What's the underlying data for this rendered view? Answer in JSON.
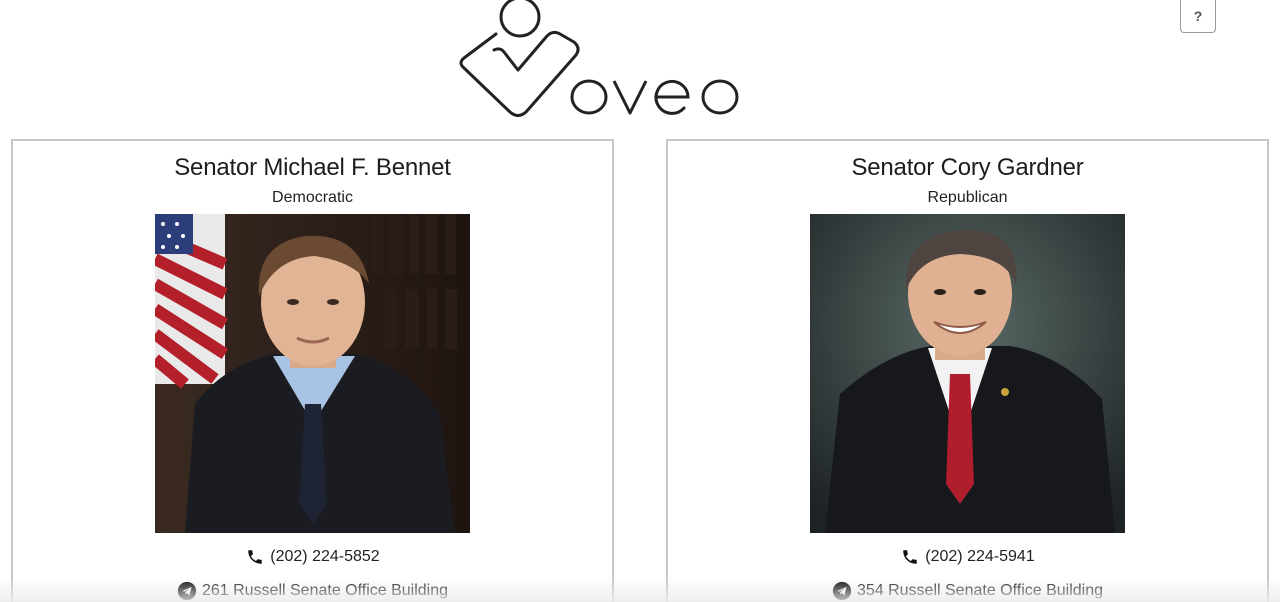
{
  "app": {
    "brand": "voveo"
  },
  "header": {
    "help_label": "?"
  },
  "senators": [
    {
      "name": "Senator Michael F. Bennet",
      "party": "Democratic",
      "phone": "(202) 224-5852",
      "office": "261 Russell Senate Office Building"
    },
    {
      "name": "Senator Cory Gardner",
      "party": "Republican",
      "phone": "(202) 224-5941",
      "office": "354 Russell Senate Office Building"
    }
  ],
  "colors": {
    "text": "#222222",
    "card_border": "#c8c8c8",
    "logo_stroke": "#222222"
  },
  "icons": {
    "phone": "phone-icon",
    "office": "send-icon",
    "help": "question-icon"
  }
}
